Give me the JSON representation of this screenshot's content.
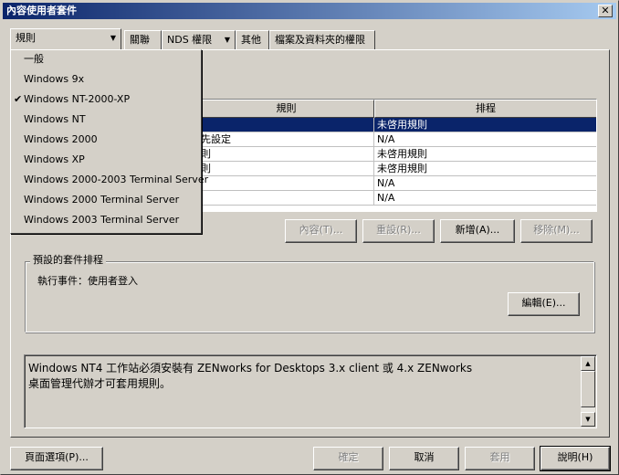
{
  "window": {
    "title": "內容使用者套件",
    "close_glyph": "✕"
  },
  "tabs": [
    {
      "label": "規則",
      "arrow": "▼"
    },
    {
      "label": "關聯"
    },
    {
      "label": "NDS 權限",
      "arrow": "▼"
    },
    {
      "label": "其他"
    },
    {
      "label": "檔案及資料夾的權限"
    }
  ],
  "dropdown": {
    "items": [
      {
        "label": "一般",
        "checked": false
      },
      {
        "label": "Windows 9x",
        "checked": false
      },
      {
        "label": "Windows NT-2000-XP",
        "checked": true
      },
      {
        "label": "Windows NT",
        "checked": false
      },
      {
        "label": "Windows 2000",
        "checked": false
      },
      {
        "label": "Windows XP",
        "checked": false
      },
      {
        "label": "Windows 2000-2003 Terminal Server",
        "checked": false
      },
      {
        "label": "Windows 2000 Terminal Server",
        "checked": false
      },
      {
        "label": "Windows 2003 Terminal Server",
        "checked": false
      }
    ],
    "check_glyph": "✔"
  },
  "table": {
    "headers": [
      "規則",
      "排程"
    ],
    "rows": [
      {
        "col1": "",
        "col2": "未啓用規則",
        "selected": true
      },
      {
        "col1": "先設定",
        "col2": "N/A",
        "selected": false
      },
      {
        "col1": "則",
        "col2": "未啓用規則",
        "selected": false
      },
      {
        "col1": "則",
        "col2": "未啓用規則",
        "selected": false
      },
      {
        "col1": "",
        "col2": "N/A",
        "selected": false
      },
      {
        "col1": "",
        "col2": "N/A",
        "selected": false
      }
    ]
  },
  "actions": {
    "properties": "內容(T)...",
    "reset": "重設(R)...",
    "add": "新增(A)...",
    "remove": "移除(M)..."
  },
  "schedule_group": {
    "legend": "預設的套件排程",
    "event_text": "執行事件：使用者登入",
    "edit_button": "編輯(E)..."
  },
  "info_text": {
    "line1": "Windows NT4 工作站必須安裝有 ZENworks for Desktops 3.x client 或 4.x ZENworks",
    "line2": "桌面管理代辦才可套用規則。"
  },
  "scrollbar": {
    "up": "▲",
    "down": "▼"
  },
  "footer": {
    "page_options": "頁面選項(P)...",
    "ok": "確定",
    "cancel": "取消",
    "apply": "套用",
    "help": "說明(H)"
  }
}
